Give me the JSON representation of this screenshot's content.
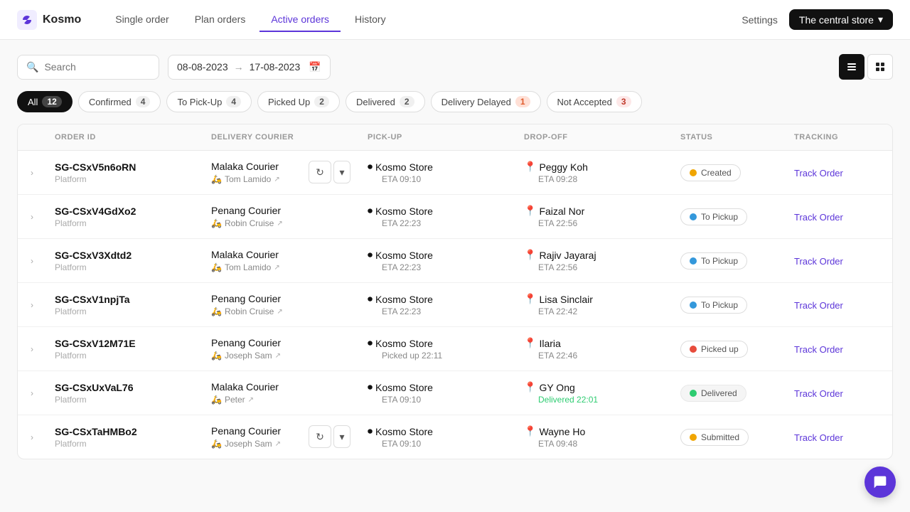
{
  "app": {
    "logo_text": "Kosmo",
    "nav": {
      "items": [
        {
          "label": "Single order",
          "active": false
        },
        {
          "label": "Plan orders",
          "active": false
        },
        {
          "label": "Active orders",
          "active": true
        },
        {
          "label": "History",
          "active": false
        }
      ],
      "settings_label": "Settings",
      "store_label": "The central store"
    }
  },
  "filters": {
    "search_placeholder": "Search",
    "date_from": "08-08-2023",
    "date_to": "17-08-2023"
  },
  "status_tabs": [
    {
      "label": "All",
      "count": "12",
      "type": "all"
    },
    {
      "label": "Confirmed",
      "count": "4",
      "type": "default"
    },
    {
      "label": "To Pick-Up",
      "count": "4",
      "type": "default"
    },
    {
      "label": "Picked Up",
      "count": "2",
      "type": "default"
    },
    {
      "label": "Delivered",
      "count": "2",
      "type": "default"
    },
    {
      "label": "Delivery Delayed",
      "count": "1",
      "type": "delayed"
    },
    {
      "label": "Not Accepted",
      "count": "3",
      "type": "not-accepted"
    }
  ],
  "table": {
    "headers": [
      "",
      "ORDER ID",
      "DELIVERY COURIER",
      "PICK-UP",
      "DROP-OFF",
      "STATUS",
      "TRACKING"
    ],
    "rows": [
      {
        "id": "SG-CSxV5n6oRN",
        "sub": "Platform",
        "courier_name": "Malaka Courier",
        "courier_person": "Tom Lamido",
        "pickup_name": "Kosmo Store",
        "pickup_eta": "ETA 09:10",
        "dropoff_name": "Peggy Koh",
        "dropoff_eta": "ETA 09:28",
        "status": "Created",
        "status_dot": "yellow",
        "track_label": "Track Order",
        "has_refresh": true
      },
      {
        "id": "SG-CSxV4GdXo2",
        "sub": "Platform",
        "courier_name": "Penang Courier",
        "courier_person": "Robin Cruise",
        "pickup_name": "Kosmo Store",
        "pickup_eta": "ETA 22:23",
        "dropoff_name": "Faizal Nor",
        "dropoff_eta": "ETA 22:56",
        "status": "To Pickup",
        "status_dot": "blue",
        "track_label": "Track Order",
        "has_refresh": false
      },
      {
        "id": "SG-CSxV3Xdtd2",
        "sub": "Platform",
        "courier_name": "Malaka Courier",
        "courier_person": "Tom Lamido",
        "pickup_name": "Kosmo Store",
        "pickup_eta": "ETA 22:23",
        "dropoff_name": "Rajiv Jayaraj",
        "dropoff_eta": "ETA 22:56",
        "status": "To Pickup",
        "status_dot": "blue",
        "track_label": "Track Order",
        "has_refresh": false
      },
      {
        "id": "SG-CSxV1npjTa",
        "sub": "Platform",
        "courier_name": "Penang Courier",
        "courier_person": "Robin Cruise",
        "pickup_name": "Kosmo Store",
        "pickup_eta": "ETA 22:23",
        "dropoff_name": "Lisa Sinclair",
        "dropoff_eta": "ETA 22:42",
        "status": "To Pickup",
        "status_dot": "blue",
        "track_label": "Track Order",
        "has_refresh": false
      },
      {
        "id": "SG-CSxV12M71E",
        "sub": "Platform",
        "courier_name": "Penang Courier",
        "courier_person": "Joseph Sam",
        "pickup_name": "Kosmo Store",
        "pickup_eta": "Picked up 22:11",
        "dropoff_name": "Ilaria",
        "dropoff_eta": "ETA 22:46",
        "status": "Picked up",
        "status_dot": "pink",
        "track_label": "Track Order",
        "has_refresh": false
      },
      {
        "id": "SG-CSxUxVaL76",
        "sub": "Platform",
        "courier_name": "Malaka Courier",
        "courier_person": "Peter",
        "pickup_name": "Kosmo Store",
        "pickup_eta": "ETA 09:10",
        "dropoff_name": "GY Ong",
        "dropoff_eta": "Delivered 22:01",
        "status": "Delivered",
        "status_dot": "green",
        "track_label": "Track Order",
        "has_refresh": false
      },
      {
        "id": "SG-CSxTaHMBo2",
        "sub": "Platform",
        "courier_name": "Penang Courier",
        "courier_person": "Joseph Sam",
        "pickup_name": "Kosmo Store",
        "pickup_eta": "ETA 09:10",
        "dropoff_name": "Wayne Ho",
        "dropoff_eta": "ETA 09:48",
        "status": "Submitted",
        "status_dot": "yellow",
        "track_label": "Track Order",
        "has_refresh": true
      }
    ]
  }
}
